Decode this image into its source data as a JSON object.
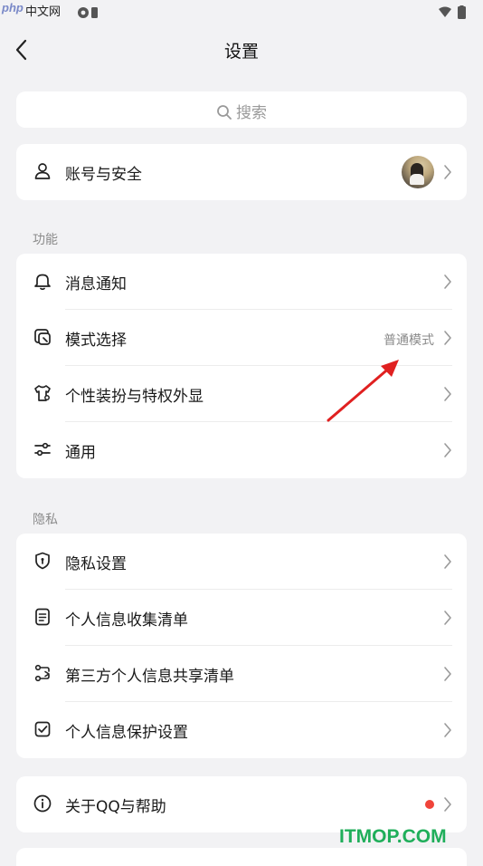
{
  "status_bar": {
    "watermark_php": "php",
    "watermark_cn": "中文网",
    "icons": [
      "settings-icon",
      "a-box-icon",
      "wifi-icon",
      "battery-icon"
    ]
  },
  "header": {
    "title": "设置",
    "back_icon": "chevron-left-icon"
  },
  "search": {
    "placeholder": "搜索"
  },
  "account": {
    "label": "账号与安全"
  },
  "sections": [
    {
      "title": "功能",
      "items": [
        {
          "label": "消息通知",
          "icon": "bell-icon"
        },
        {
          "label": "模式选择",
          "icon": "mode-icon",
          "value": "普通模式"
        },
        {
          "label": "个性装扮与特权外显",
          "icon": "shirt-icon"
        },
        {
          "label": "通用",
          "icon": "sliders-icon"
        }
      ]
    },
    {
      "title": "隐私",
      "items": [
        {
          "label": "隐私设置",
          "icon": "shield-icon"
        },
        {
          "label": "个人信息收集清单",
          "icon": "document-icon"
        },
        {
          "label": "第三方个人信息共享清单",
          "icon": "share-icon"
        },
        {
          "label": "个人信息保护设置",
          "icon": "checkbox-icon"
        }
      ]
    }
  ],
  "about": {
    "label": "关于QQ与帮助",
    "icon": "info-icon",
    "badge_color": "#f0443a"
  },
  "footer_watermark": "ITMOP.COM",
  "colors": {
    "background": "#f2f2f4",
    "card": "#ffffff",
    "annotation_arrow": "#e02020"
  }
}
